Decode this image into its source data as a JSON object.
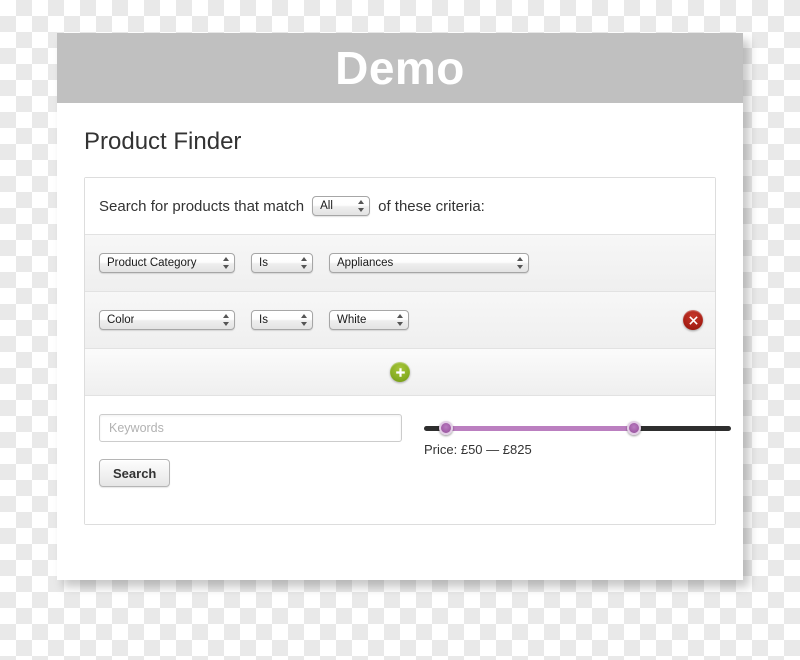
{
  "header": {
    "title": "Demo"
  },
  "page": {
    "title": "Product Finder"
  },
  "criteria_intro": {
    "prefix": "Search for products that match",
    "match_value": "All",
    "suffix": "of these criteria:"
  },
  "criteria_rows": [
    {
      "field": "Product Category",
      "operator": "Is",
      "value": "Appliances",
      "has_remove": false
    },
    {
      "field": "Color",
      "operator": "Is",
      "value": "White",
      "has_remove": true
    }
  ],
  "add_row": {
    "icon": "plus-icon",
    "label": "+"
  },
  "remove_button": {
    "icon": "close-circle-icon",
    "label": "✕"
  },
  "footer": {
    "keywords_placeholder": "Keywords",
    "keywords_value": "",
    "search_label": "Search",
    "price_label": "Price: £50 — £825"
  },
  "price_slider": {
    "min_value": "£50",
    "max_value": "£825",
    "range_min": 0,
    "range_max": 1000,
    "selected_min": 50,
    "selected_max": 825
  },
  "colors": {
    "header_bar": "#c0c0c0",
    "slider_track": "#2e2e2e",
    "slider_range": "#bb7fc0",
    "slider_handle": "#a25fa8",
    "remove_button": "#a81f15",
    "add_button": "#86ad22"
  }
}
